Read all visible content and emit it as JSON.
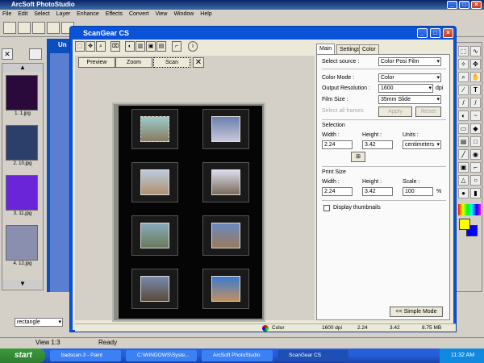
{
  "app": {
    "title": "ArcSoft PhotoStudio",
    "menu": [
      "File",
      "Edit",
      "Select",
      "Layer",
      "Enhance",
      "Effects",
      "Convert",
      "View",
      "Window",
      "Help"
    ],
    "album_thumbs": [
      {
        "label": "1. 1.jpg",
        "color": "#2a0a3a"
      },
      {
        "label": "2. 10.jpg",
        "color": "#2c3f6a"
      },
      {
        "label": "3. 11.jpg",
        "color": "#6b25d9"
      },
      {
        "label": "4. 12.jpg",
        "color": "#8a8fb0"
      }
    ],
    "doc_title": "Un",
    "shape_select": "rectangle",
    "status": {
      "view": "View 1:3",
      "ready": "Ready"
    }
  },
  "scangear": {
    "title": "ScanGear CS",
    "buttons": {
      "preview": "Preview",
      "zoom": "Zoom",
      "scan": "Scan"
    },
    "tabs": [
      "Main",
      "Settings",
      "Color"
    ],
    "select_source_label": "Select source :",
    "select_source_value": "Color Posi Film",
    "color_mode_label": "Color Mode :",
    "color_mode_value": "Color",
    "output_res_label": "Output Resolution :",
    "output_res_value": "1600",
    "dpi": "dpi",
    "film_size_label": "Film Size :",
    "film_size_value": "35mm Slide",
    "select_all_label": "Select all frames",
    "apply": "Apply",
    "reset": "Reset",
    "selection_label": "Selection",
    "width_label": "Width :",
    "height_label": "Height :",
    "units_label": "Units :",
    "sel_width": "2.24",
    "sel_height": "3.42",
    "units_value": "centimeters",
    "print_size_label": "Print Size",
    "print_width": "2.24",
    "print_height": "3.42",
    "scale_label": "Scale :",
    "scale_value": "100",
    "percent": "%",
    "display_thumbs": "Display thumbnails",
    "simple_mode": "<< Simple Mode",
    "status": {
      "color": "Color",
      "dpi": "1600 dpi",
      "w": "2.24",
      "h": "3.42",
      "size": "8.75 MB"
    }
  },
  "taskbar": {
    "start": "start",
    "tasks": [
      "badscan-3 - Paint",
      "C:\\WINDOWS\\Syste...",
      "ArcSoft PhotoStudio",
      "ScanGear CS"
    ],
    "clock": "11:32 AM"
  }
}
